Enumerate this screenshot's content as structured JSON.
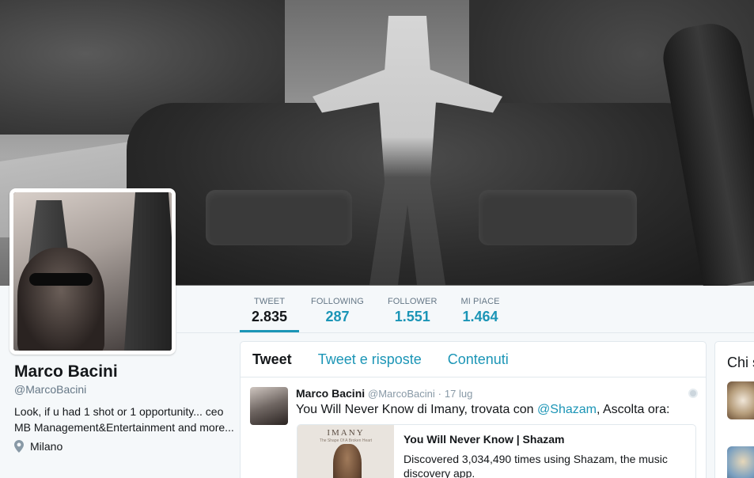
{
  "profile": {
    "name": "Marco Bacini",
    "handle": "@MarcoBacini",
    "bio": "Look, if u had 1 shot or 1 opportunity... ceo MB Management&Entertainment and more...",
    "location": "Milano"
  },
  "stats": [
    {
      "label": "TWEET",
      "value": "2.835",
      "active": true
    },
    {
      "label": "FOLLOWING",
      "value": "287",
      "active": false
    },
    {
      "label": "FOLLOWER",
      "value": "1.551",
      "active": false
    },
    {
      "label": "MI PIACE",
      "value": "1.464",
      "active": false
    }
  ],
  "tabs": [
    {
      "label": "Tweet",
      "active": true
    },
    {
      "label": "Tweet e risposte",
      "active": false
    },
    {
      "label": "Contenuti",
      "active": false
    }
  ],
  "tweet": {
    "author": "Marco Bacini",
    "handle": "@MarcoBacini",
    "time": "17 lug",
    "text_before": "You Will Never Know di Imany, trovata con ",
    "mention": "@Shazam",
    "text_after": ", Ascolta ora:",
    "card": {
      "album_artist": "IMANY",
      "album_subtitle": "The Shape Of A Broken Heart",
      "title": "You Will Never Know | Shazam",
      "description": "Discovered 3,034,490 times using Shazam, the music discovery app."
    }
  },
  "sidebar": {
    "title": "Chi s"
  },
  "colors": {
    "accent": "#1b95b6",
    "background": "#f5f8fa",
    "muted": "#657786"
  }
}
